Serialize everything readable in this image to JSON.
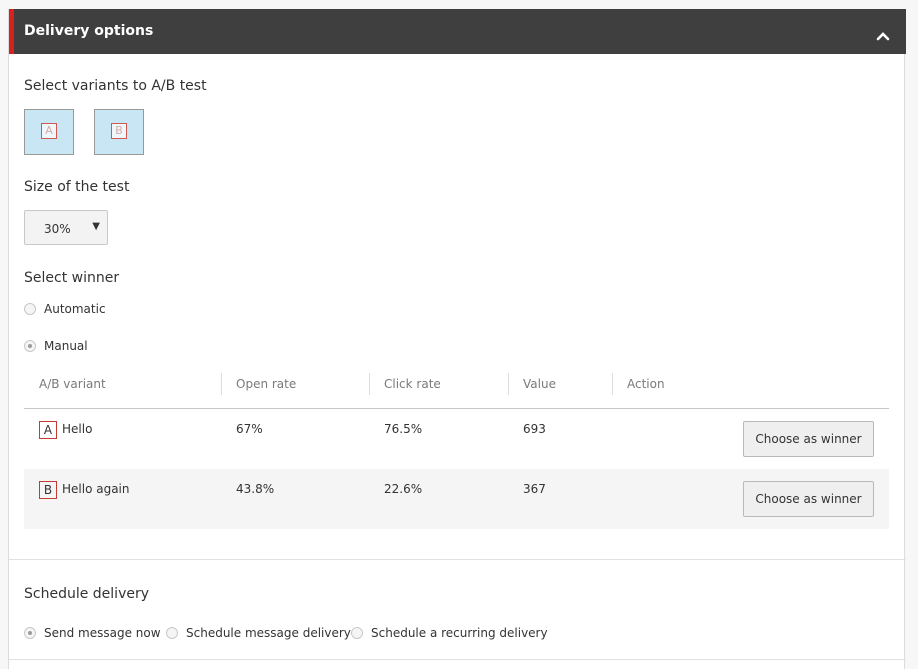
{
  "header": {
    "title": "Delivery options"
  },
  "ab_test": {
    "section_title": "Select variants to A/B test",
    "variants": [
      "A",
      "B"
    ]
  },
  "test_size": {
    "section_title": "Size of the test",
    "selected": "30%"
  },
  "winner": {
    "section_title": "Select winner",
    "options": [
      {
        "label": "Automatic",
        "checked": false
      },
      {
        "label": "Manual",
        "checked": true
      }
    ]
  },
  "results_table": {
    "columns": [
      "A/B variant",
      "Open rate",
      "Click rate",
      "Value",
      "Action"
    ],
    "rows": [
      {
        "badge": "A",
        "name": "Hello",
        "open_rate": "67%",
        "click_rate": "76.5%",
        "value": "693",
        "action": "Choose as winner"
      },
      {
        "badge": "B",
        "name": "Hello again",
        "open_rate": "43.8%",
        "click_rate": "22.6%",
        "value": "367",
        "action": "Choose as winner"
      }
    ]
  },
  "schedule": {
    "section_title": "Schedule delivery",
    "options": [
      {
        "label": "Send message now",
        "checked": true
      },
      {
        "label": "Schedule message delivery",
        "checked": false
      },
      {
        "label": "Schedule a recurring delivery",
        "checked": false
      }
    ]
  },
  "colors": {
    "header_bg": "#403f3f",
    "accent_red": "#d6211c",
    "variant_tile_bg": "#c9e6f4"
  },
  "icons": {
    "collapse": "chevron-up-icon"
  }
}
